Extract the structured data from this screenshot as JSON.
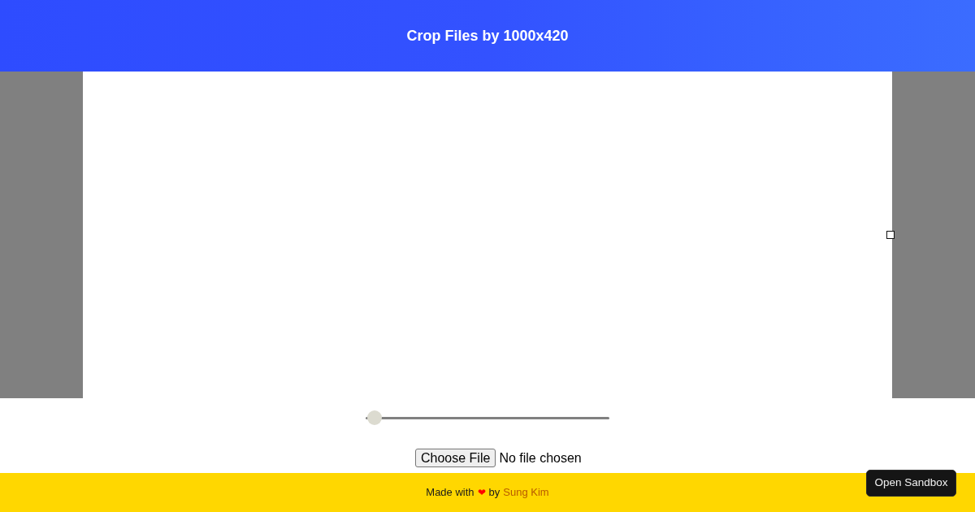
{
  "header": {
    "title": "Crop Files by 1000x420"
  },
  "zoom_slider": {
    "level": 0
  },
  "file_input": {
    "button": "Choose File",
    "status": "No file chosen"
  },
  "footer": {
    "made_with": "Made with",
    "heart": "❤",
    "by": "by",
    "author_link": "Sung Kim"
  },
  "sandbox_button": {
    "label": "Open Sandbox"
  }
}
